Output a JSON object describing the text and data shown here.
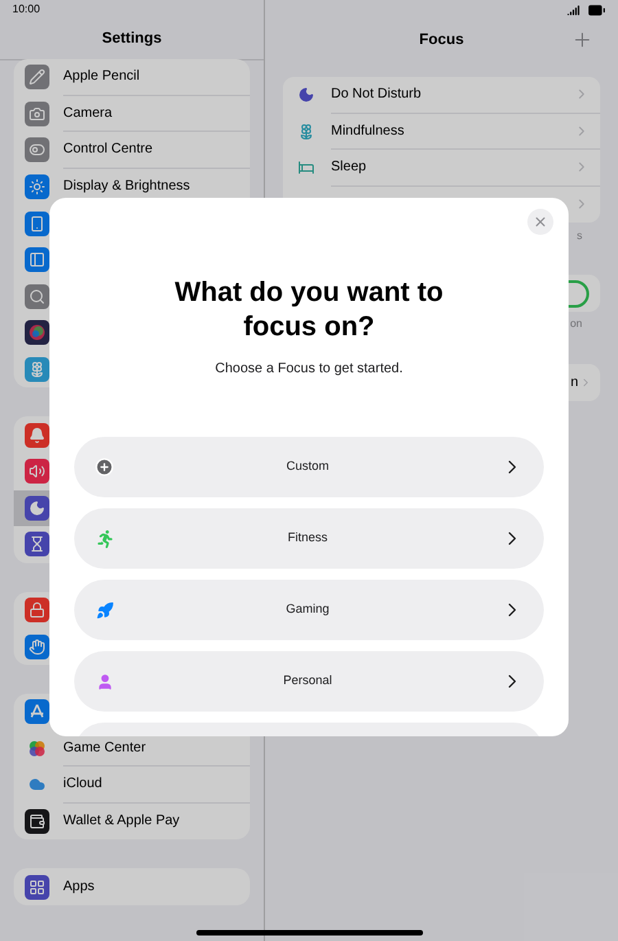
{
  "status_bar": {
    "time": "10:00"
  },
  "sidebar": {
    "title": "Settings",
    "groups": [
      {
        "items": [
          {
            "kind": "pencil",
            "label": "Apple Pencil",
            "selected": false
          },
          {
            "kind": "camera",
            "label": "Camera",
            "selected": false
          },
          {
            "kind": "toggles",
            "label": "Control Centre",
            "selected": false
          },
          {
            "kind": "sun",
            "label": "Display & Brightness",
            "selected": false
          },
          {
            "kind": "screen",
            "selected": false
          },
          {
            "kind": "panel",
            "selected": false
          },
          {
            "kind": "search",
            "selected": false
          },
          {
            "kind": "orb",
            "selected": false
          },
          {
            "kind": "flower",
            "selected": false
          }
        ]
      },
      {
        "items": [
          {
            "kind": "bell",
            "selected": false
          },
          {
            "kind": "speaker",
            "selected": false
          },
          {
            "kind": "moon",
            "selected": true
          },
          {
            "kind": "hourglass",
            "selected": false
          }
        ]
      },
      {
        "items": [
          {
            "kind": "lock",
            "selected": false
          },
          {
            "kind": "hand",
            "selected": false
          }
        ]
      },
      {
        "items": [
          {
            "kind": "appstore",
            "selected": false
          },
          {
            "kind": "gamecenter",
            "label": "Game Center",
            "selected": false
          },
          {
            "kind": "cloud",
            "label": "iCloud",
            "selected": false
          },
          {
            "kind": "wallet",
            "label": "Wallet & Apple Pay",
            "selected": false
          }
        ]
      },
      {
        "items": [
          {
            "kind": "apps",
            "label": "Apps",
            "selected": false
          }
        ]
      }
    ]
  },
  "detail": {
    "title": "Focus",
    "focus_modes": [
      {
        "kind": "moon",
        "label": "Do Not Disturb"
      },
      {
        "kind": "flower",
        "label": "Mindfulness"
      },
      {
        "kind": "bed",
        "label": "Sleep"
      },
      {
        "kind": "other"
      }
    ],
    "footer_1": "s",
    "toggle": {
      "on": true
    },
    "footer_2": "on",
    "row_3": "n"
  },
  "dialog": {
    "title": "What do you want to focus on?",
    "subtitle": "Choose a Focus to get started.",
    "options": [
      {
        "kind": "custom",
        "label": "Custom"
      },
      {
        "kind": "fitness",
        "label": "Fitness"
      },
      {
        "kind": "gaming",
        "label": "Gaming"
      },
      {
        "kind": "personal",
        "label": "Personal"
      },
      {
        "kind": "more"
      }
    ]
  }
}
